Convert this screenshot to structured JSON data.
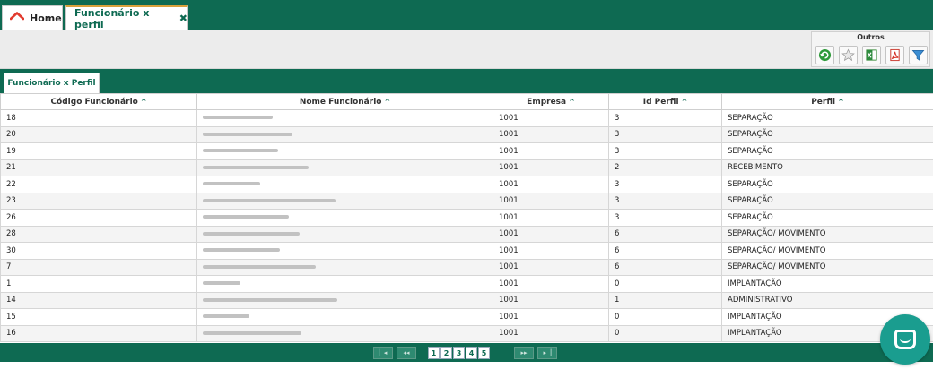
{
  "tabs": {
    "home_label": "Home",
    "active_label": "Funcionário x perfil",
    "close_glyph": "✖"
  },
  "toolbar": {
    "group_label": "Outros",
    "buttons": [
      "refresh-icon",
      "star-icon",
      "excel-icon",
      "pdf-icon",
      "filter-icon"
    ]
  },
  "panel": {
    "tab_label": "Funcionário x Perfil"
  },
  "grid": {
    "sort_glyph": "^",
    "columns": [
      "Código Funcionário",
      "Nome Funcionário",
      "Empresa",
      "Id Perfil",
      "Perfil"
    ],
    "rows": [
      {
        "codigo": "18",
        "empresa": "1001",
        "id_perfil": "3",
        "perfil": "SEPARAÇÃO"
      },
      {
        "codigo": "20",
        "empresa": "1001",
        "id_perfil": "3",
        "perfil": "SEPARAÇÃO"
      },
      {
        "codigo": "19",
        "empresa": "1001",
        "id_perfil": "3",
        "perfil": "SEPARAÇÃO"
      },
      {
        "codigo": "21",
        "empresa": "1001",
        "id_perfil": "2",
        "perfil": "RECEBIMENTO"
      },
      {
        "codigo": "22",
        "empresa": "1001",
        "id_perfil": "3",
        "perfil": "SEPARAÇÃO"
      },
      {
        "codigo": "23",
        "empresa": "1001",
        "id_perfil": "3",
        "perfil": "SEPARAÇÃO"
      },
      {
        "codigo": "26",
        "empresa": "1001",
        "id_perfil": "3",
        "perfil": "SEPARAÇÃO"
      },
      {
        "codigo": "28",
        "empresa": "1001",
        "id_perfil": "6",
        "perfil": "SEPARAÇÃO/ MOVIMENTO"
      },
      {
        "codigo": "30",
        "empresa": "1001",
        "id_perfil": "6",
        "perfil": "SEPARAÇÃO/ MOVIMENTO"
      },
      {
        "codigo": "7",
        "empresa": "1001",
        "id_perfil": "6",
        "perfil": "SEPARAÇÃO/ MOVIMENTO"
      },
      {
        "codigo": "1",
        "empresa": "1001",
        "id_perfil": "0",
        "perfil": "IMPLANTAÇÃO"
      },
      {
        "codigo": "14",
        "empresa": "1001",
        "id_perfil": "1",
        "perfil": "ADMINISTRATIVO"
      },
      {
        "codigo": "15",
        "empresa": "1001",
        "id_perfil": "0",
        "perfil": "IMPLANTAÇÃO"
      },
      {
        "codigo": "16",
        "empresa": "1001",
        "id_perfil": "0",
        "perfil": "IMPLANTAÇÃO"
      }
    ]
  },
  "pager": {
    "pages": [
      "1",
      "2",
      "3",
      "4",
      "5"
    ]
  },
  "colors": {
    "brand": "#0e6a52",
    "tab_accent": "#d9a13b",
    "chat": "#1a9d8f"
  }
}
